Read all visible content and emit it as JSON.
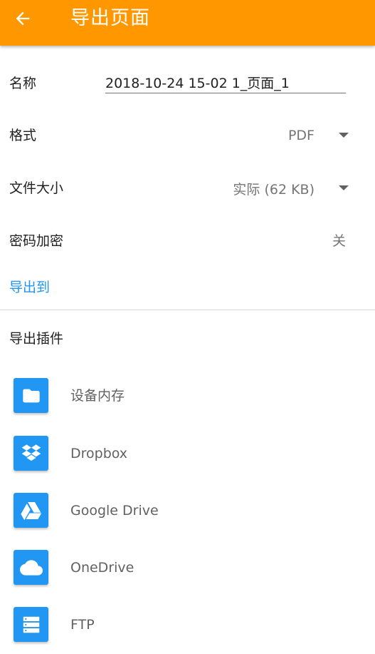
{
  "app_bar": {
    "title": "导出页面",
    "back_icon": "arrow-left-icon",
    "color": "#ff9800"
  },
  "form": {
    "name_label": "名称",
    "name_value": "2018-10-24 15-02 1_页面_1",
    "format_label": "格式",
    "format_value": "PDF",
    "filesize_label": "文件大小",
    "filesize_value": "实际 (62 KB)",
    "password_label": "密码加密",
    "password_value": "关",
    "export_to_label": "导出到",
    "link_color": "#2196f3"
  },
  "plugins": {
    "title": "导出插件",
    "items": [
      {
        "label": "设备内存",
        "icon": "folder-icon"
      },
      {
        "label": "Dropbox",
        "icon": "dropbox-icon"
      },
      {
        "label": "Google Drive",
        "icon": "google-drive-icon"
      },
      {
        "label": "OneDrive",
        "icon": "onedrive-icon"
      },
      {
        "label": "FTP",
        "icon": "ftp-server-icon"
      }
    ]
  }
}
